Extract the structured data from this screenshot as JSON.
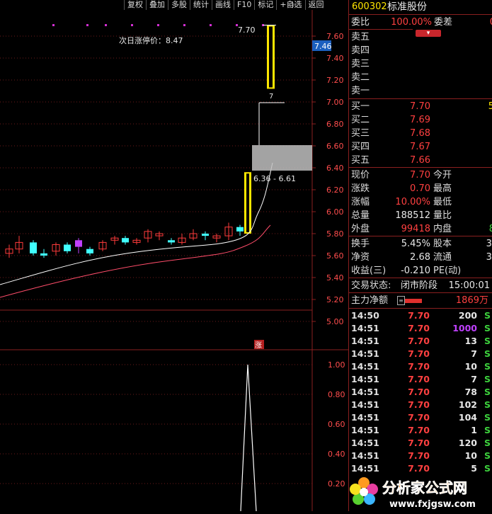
{
  "toolbar": {
    "buttons": [
      "复权",
      "叠加",
      "多股",
      "统计",
      "画线",
      "F10",
      "标记",
      "+自选",
      "返回"
    ],
    "diamond_icon": "◇"
  },
  "chart": {
    "next_limit_label": "次日涨停价：8.47",
    "high_label": "7.70",
    "gap_label": "6.36 - 6.61",
    "bar_7_label": "7",
    "current_price_tag": "7.46",
    "limit_mark": "涨",
    "price_axis": [
      "7.60",
      "7.40",
      "7.20",
      "7.00",
      "6.80",
      "6.60",
      "6.40",
      "6.20",
      "6.00",
      "5.80",
      "5.60",
      "5.40",
      "5.20",
      "5.00"
    ],
    "indicator_axis": [
      "1.00",
      "0.80",
      "0.60",
      "0.40",
      "0.20"
    ],
    "colors": {
      "up": "#ff3b3b",
      "down": "#40ffff",
      "limit": "#ffe600",
      "ma1": "#ffffff",
      "ma2": "#ff4d6a",
      "grid": "#8a1f1f"
    }
  },
  "quote": {
    "code": "600302",
    "name": "标准股份",
    "weibi_label": "委比",
    "weibi_value": "100.00%",
    "weicha_label": "委差",
    "weicha_value": "0",
    "weicha_badge": "▾",
    "sell": [
      {
        "label": "卖五"
      },
      {
        "label": "卖四"
      },
      {
        "label": "卖三"
      },
      {
        "label": "卖二"
      },
      {
        "label": "卖一"
      }
    ],
    "buy": [
      {
        "label": "买一",
        "price": "7.70",
        "vol": "5"
      },
      {
        "label": "买二",
        "price": "7.69",
        "vol": ""
      },
      {
        "label": "买三",
        "price": "7.68",
        "vol": ""
      },
      {
        "label": "买四",
        "price": "7.67",
        "vol": ""
      },
      {
        "label": "买五",
        "price": "7.66",
        "vol": ""
      }
    ],
    "stats": [
      {
        "l1": "现价",
        "v1": "7.70",
        "c1": "red",
        "l2": "今开",
        "v2": ""
      },
      {
        "l1": "涨跌",
        "v1": "0.70",
        "c1": "red",
        "l2": "最高",
        "v2": ""
      },
      {
        "l1": "涨幅",
        "v1": "10.00%",
        "c1": "red",
        "l2": "最低",
        "v2": ""
      },
      {
        "l1": "总量",
        "v1": "188512",
        "c1": "white",
        "l2": "量比",
        "v2": ""
      },
      {
        "l1": "外盘",
        "v1": "99418",
        "c1": "red",
        "l2": "内盘",
        "v2": "8"
      }
    ],
    "stats2": [
      {
        "l1": "换手",
        "v1": "5.45%",
        "c1": "white",
        "l2": "股本",
        "v2": "3."
      },
      {
        "l1": "净资",
        "v1": "2.68",
        "c1": "white",
        "l2": "流通",
        "v2": "3."
      },
      {
        "l1": "收益(三)",
        "v1": "-0.210",
        "c1": "white",
        "l2": "PE(动)",
        "v2": ""
      }
    ],
    "trade_status_label": "交易状态:",
    "trade_status_value": "闭市阶段",
    "trade_status_time": "15:00:01",
    "main_flow_label": "主力净额",
    "main_flow_value": "1869万"
  },
  "ticks": [
    {
      "time": "14:50",
      "price": "7.70",
      "vol": "200",
      "side": "S",
      "vc": "white"
    },
    {
      "time": "14:51",
      "price": "7.70",
      "vol": "1000",
      "side": "S",
      "vc": "purple"
    },
    {
      "time": "14:51",
      "price": "7.70",
      "vol": "13",
      "side": "S",
      "vc": "white"
    },
    {
      "time": "14:51",
      "price": "7.70",
      "vol": "7",
      "side": "S",
      "vc": "white"
    },
    {
      "time": "14:51",
      "price": "7.70",
      "vol": "10",
      "side": "S",
      "vc": "white"
    },
    {
      "time": "14:51",
      "price": "7.70",
      "vol": "7",
      "side": "S",
      "vc": "white"
    },
    {
      "time": "14:51",
      "price": "7.70",
      "vol": "78",
      "side": "S",
      "vc": "white"
    },
    {
      "time": "14:51",
      "price": "7.70",
      "vol": "102",
      "side": "S",
      "vc": "white"
    },
    {
      "time": "14:51",
      "price": "7.70",
      "vol": "104",
      "side": "S",
      "vc": "white"
    },
    {
      "time": "14:51",
      "price": "7.70",
      "vol": "1",
      "side": "S",
      "vc": "white"
    },
    {
      "time": "14:51",
      "price": "7.70",
      "vol": "120",
      "side": "S",
      "vc": "white"
    },
    {
      "time": "14:51",
      "price": "7.70",
      "vol": "10",
      "side": "S",
      "vc": "white"
    },
    {
      "time": "14:51",
      "price": "7.70",
      "vol": "5",
      "side": "S",
      "vc": "white"
    }
  ],
  "watermark": {
    "title": "分析家公式网",
    "url": "www.fxjgsw.com"
  }
}
